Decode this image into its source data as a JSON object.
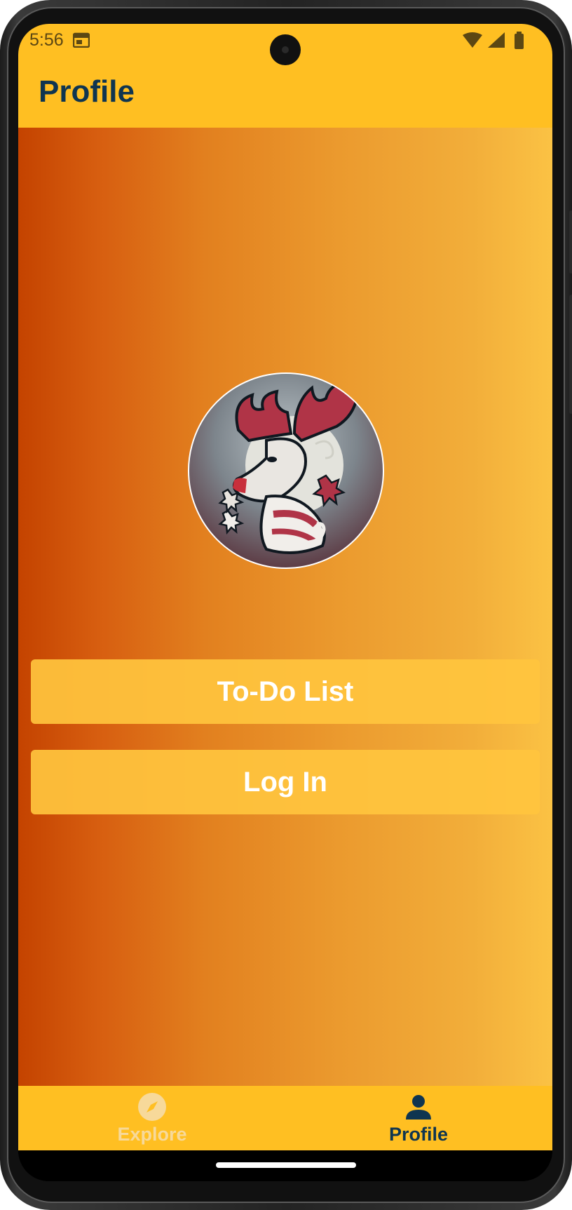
{
  "status_bar": {
    "time": "5:56"
  },
  "app_bar": {
    "title": "Profile"
  },
  "profile": {
    "avatar_icon": "moose-logo-icon"
  },
  "buttons": {
    "todo_label": "To-Do List",
    "login_label": "Log In"
  },
  "bottom_nav": {
    "items": [
      {
        "label": "Explore",
        "icon": "compass-icon",
        "active": false
      },
      {
        "label": "Profile",
        "icon": "person-icon",
        "active": true
      }
    ]
  },
  "colors": {
    "app_bar": "#ffbf22",
    "title_text": "#0f3550",
    "gradient_start": "#c44300",
    "gradient_end": "#fbc244",
    "button_bg": "#ffc43e",
    "nav_active": "#0f3550",
    "nav_inactive": "#f7d99a"
  }
}
